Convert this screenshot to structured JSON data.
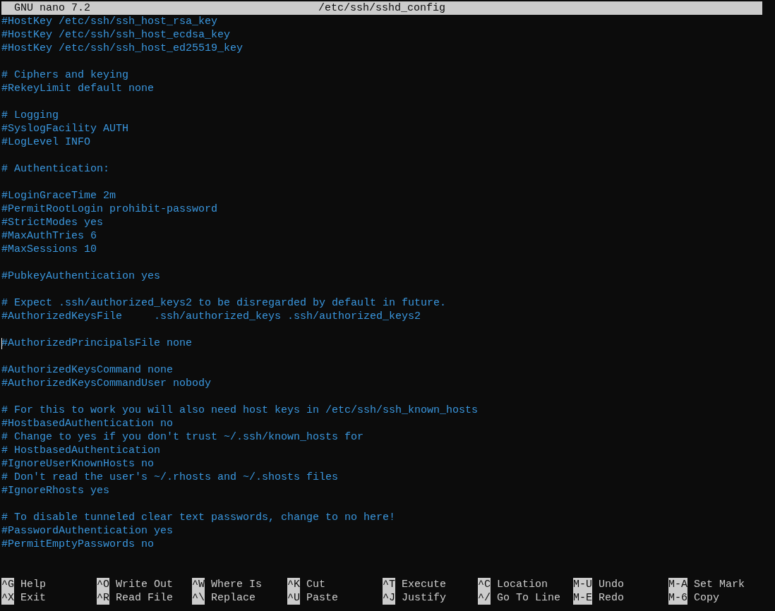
{
  "title_bar": {
    "app": "GNU nano 7.2",
    "file": "/etc/ssh/sshd_config"
  },
  "lines": [
    {
      "kind": "text",
      "text": "#HostKey /etc/ssh/ssh_host_rsa_key",
      "cursor": false
    },
    {
      "kind": "text",
      "text": "#HostKey /etc/ssh/ssh_host_ecdsa_key",
      "cursor": false
    },
    {
      "kind": "text",
      "text": "#HostKey /etc/ssh/ssh_host_ed25519_key",
      "cursor": false
    },
    {
      "kind": "blank"
    },
    {
      "kind": "text",
      "text": "# Ciphers and keying",
      "cursor": false
    },
    {
      "kind": "text",
      "text": "#RekeyLimit default none",
      "cursor": false
    },
    {
      "kind": "blank"
    },
    {
      "kind": "text",
      "text": "# Logging",
      "cursor": false
    },
    {
      "kind": "text",
      "text": "#SyslogFacility AUTH",
      "cursor": false
    },
    {
      "kind": "text",
      "text": "#LogLevel INFO",
      "cursor": false
    },
    {
      "kind": "blank"
    },
    {
      "kind": "text",
      "text": "# Authentication:",
      "cursor": false
    },
    {
      "kind": "blank"
    },
    {
      "kind": "text",
      "text": "#LoginGraceTime 2m",
      "cursor": false
    },
    {
      "kind": "text",
      "text": "#PermitRootLogin prohibit-password",
      "cursor": false
    },
    {
      "kind": "text",
      "text": "#StrictModes yes",
      "cursor": false
    },
    {
      "kind": "text",
      "text": "#MaxAuthTries 6",
      "cursor": false
    },
    {
      "kind": "text",
      "text": "#MaxSessions 10",
      "cursor": false
    },
    {
      "kind": "blank"
    },
    {
      "kind": "text",
      "text": "#PubkeyAuthentication yes",
      "cursor": false
    },
    {
      "kind": "blank"
    },
    {
      "kind": "text",
      "text": "# Expect .ssh/authorized_keys2 to be disregarded by default in future.",
      "cursor": false
    },
    {
      "kind": "text",
      "text": "#AuthorizedKeysFile     .ssh/authorized_keys .ssh/authorized_keys2",
      "cursor": false
    },
    {
      "kind": "blank"
    },
    {
      "kind": "text",
      "text": "#AuthorizedPrincipalsFile none",
      "cursor": true
    },
    {
      "kind": "blank"
    },
    {
      "kind": "text",
      "text": "#AuthorizedKeysCommand none",
      "cursor": false
    },
    {
      "kind": "text",
      "text": "#AuthorizedKeysCommandUser nobody",
      "cursor": false
    },
    {
      "kind": "blank"
    },
    {
      "kind": "text",
      "text": "# For this to work you will also need host keys in /etc/ssh/ssh_known_hosts",
      "cursor": false
    },
    {
      "kind": "text",
      "text": "#HostbasedAuthentication no",
      "cursor": false
    },
    {
      "kind": "text",
      "text": "# Change to yes if you don't trust ~/.ssh/known_hosts for",
      "cursor": false
    },
    {
      "kind": "text",
      "text": "# HostbasedAuthentication",
      "cursor": false
    },
    {
      "kind": "text",
      "text": "#IgnoreUserKnownHosts no",
      "cursor": false
    },
    {
      "kind": "text",
      "text": "# Don't read the user's ~/.rhosts and ~/.shosts files",
      "cursor": false
    },
    {
      "kind": "text",
      "text": "#IgnoreRhosts yes",
      "cursor": false
    },
    {
      "kind": "blank"
    },
    {
      "kind": "text",
      "text": "# To disable tunneled clear text passwords, change to no here!",
      "cursor": false
    },
    {
      "kind": "text",
      "text": "#PasswordAuthentication yes",
      "cursor": false
    },
    {
      "kind": "text",
      "text": "#PermitEmptyPasswords no",
      "cursor": false
    }
  ],
  "shortcuts": [
    [
      {
        "key": "^G",
        "label": "Help"
      },
      {
        "key": "^X",
        "label": "Exit"
      }
    ],
    [
      {
        "key": "^O",
        "label": "Write Out"
      },
      {
        "key": "^R",
        "label": "Read File"
      }
    ],
    [
      {
        "key": "^W",
        "label": "Where Is"
      },
      {
        "key": "^\\",
        "label": "Replace"
      }
    ],
    [
      {
        "key": "^K",
        "label": "Cut"
      },
      {
        "key": "^U",
        "label": "Paste"
      }
    ],
    [
      {
        "key": "^T",
        "label": "Execute"
      },
      {
        "key": "^J",
        "label": "Justify"
      }
    ],
    [
      {
        "key": "^C",
        "label": "Location"
      },
      {
        "key": "^/",
        "label": "Go To Line"
      }
    ],
    [
      {
        "key": "M-U",
        "label": "Undo"
      },
      {
        "key": "M-E",
        "label": "Redo"
      }
    ],
    [
      {
        "key": "M-A",
        "label": "Set Mark"
      },
      {
        "key": "M-6",
        "label": "Copy"
      }
    ]
  ]
}
